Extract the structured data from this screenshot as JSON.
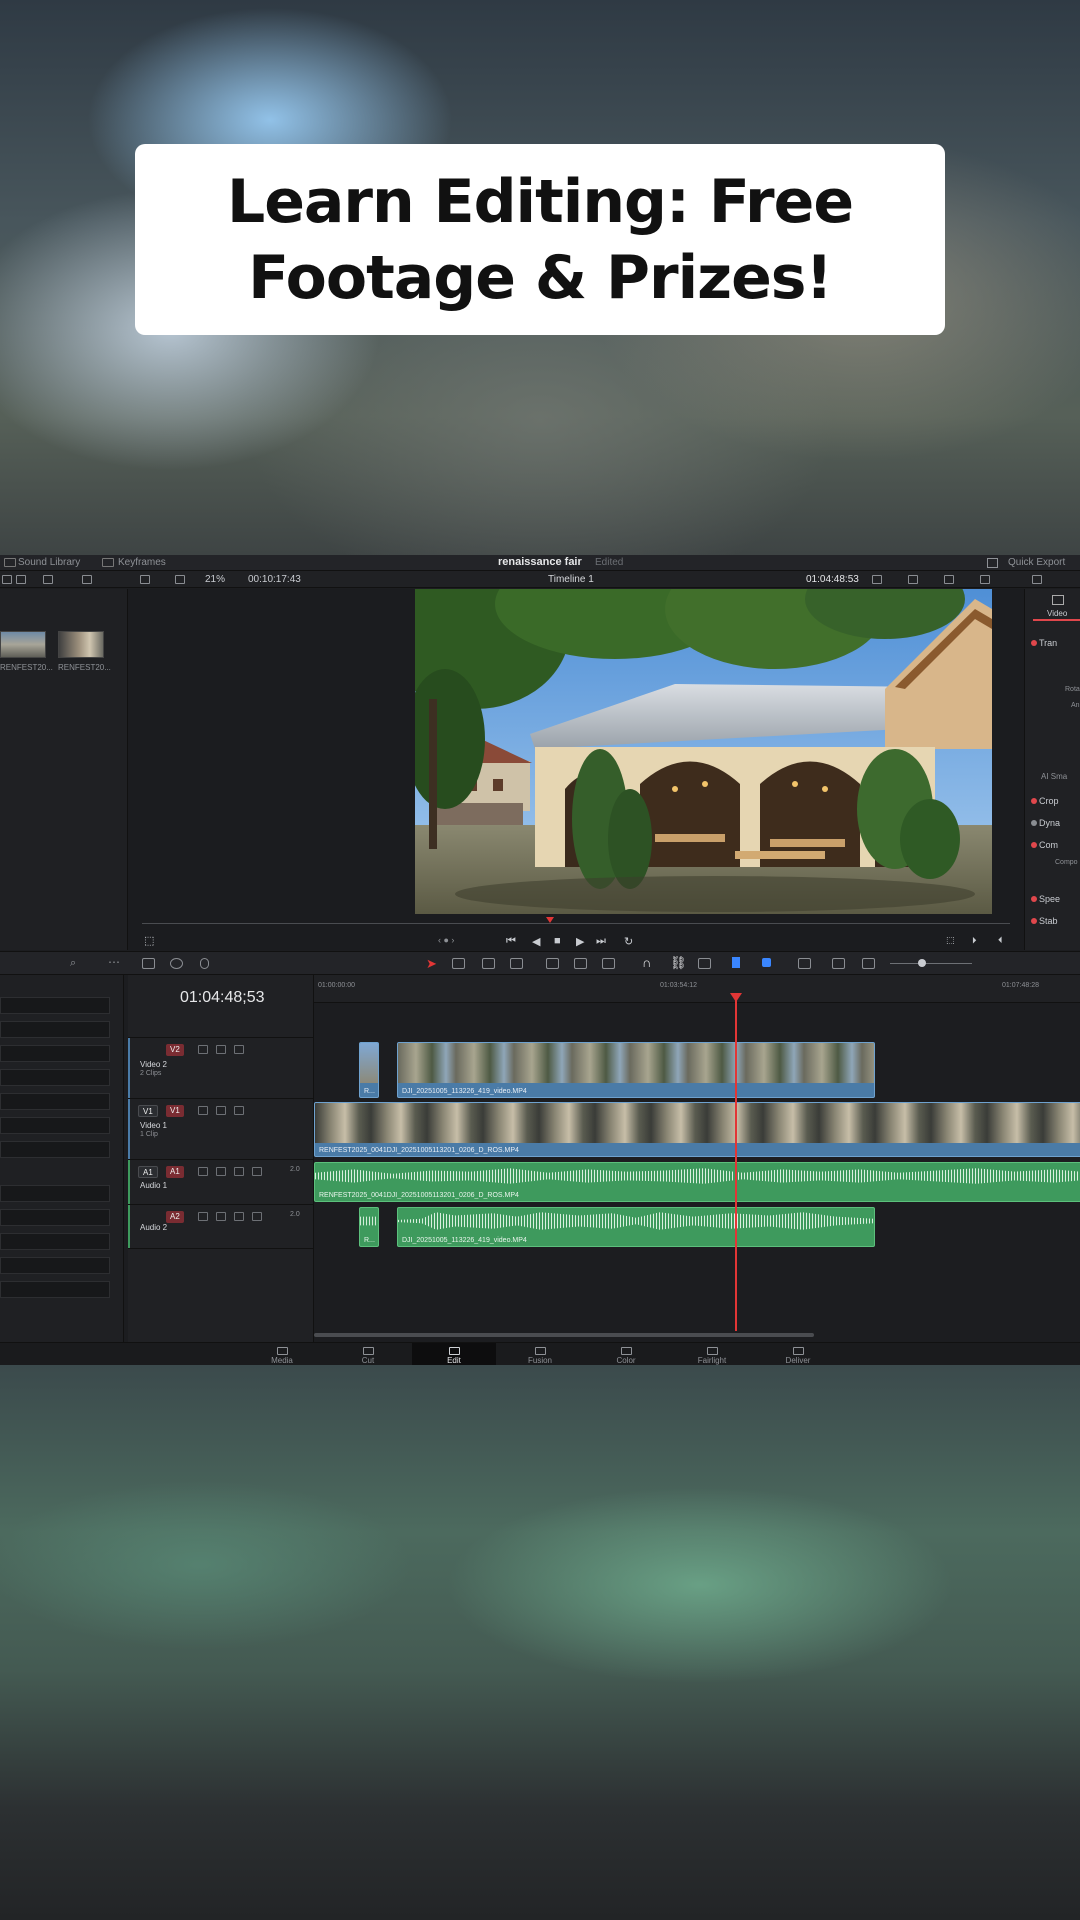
{
  "overlay": {
    "title_line1": "Learn Editing: Free",
    "title_line2": "Footage & Prizes!"
  },
  "topbar": {
    "sound_library": "Sound Library",
    "keyframes": "Keyframes",
    "project_name": "renaissance fair",
    "edited_status": "Edited",
    "quick_export": "Quick Export"
  },
  "viewer_bar": {
    "zoom": "21%",
    "source_timecode": "00:10:17:43",
    "timeline_name": "Timeline 1",
    "record_timecode": "01:04:48:53"
  },
  "media_pool": {
    "clips": [
      "RENFEST20...",
      "RENFEST20..."
    ]
  },
  "inspector": {
    "tab_label": "Video",
    "items": [
      "Tran",
      "AI Sma",
      "Crop",
      "Dyna",
      "Com",
      "Spee",
      "Stab"
    ],
    "sub_labels": [
      "Rota",
      "An",
      "Compo"
    ]
  },
  "timeline": {
    "timecode": "01:04:48;53",
    "ruler": [
      "01:00:00:00",
      "01:03:54:12",
      "01:07:48:28"
    ],
    "tracks": [
      {
        "badge": "V2",
        "name": "Video 2",
        "info": "2 Clips"
      },
      {
        "badge": "V1",
        "name": "Video 1",
        "info": "1 Clip"
      },
      {
        "badge": "A1",
        "name": "Audio 1",
        "channels": "2.0"
      },
      {
        "badge": "A2",
        "name": "Audio 2",
        "channels": "2.0"
      }
    ],
    "clips": {
      "v2_small": "R...",
      "v2_main": "DJI_20251005_113226_419_video.MP4",
      "v1_main": "RENFEST2025_0041DJI_20251005113201_0206_D_ROS.MP4",
      "a1_main": "RENFEST2025_0041DJI_20251005113201_0206_D_ROS.MP4",
      "a2_small": "R...",
      "a2_main": "DJI_20251005_113226_419_video.MP4"
    }
  },
  "pages": [
    "Media",
    "Cut",
    "Edit",
    "Fusion",
    "Color",
    "Fairlight",
    "Deliver"
  ],
  "active_page": "Edit",
  "colors": {
    "video_clip": "#4a7ba7",
    "audio_clip": "#3e9a5d",
    "playhead": "#e23636",
    "accent": "#e0474c"
  }
}
